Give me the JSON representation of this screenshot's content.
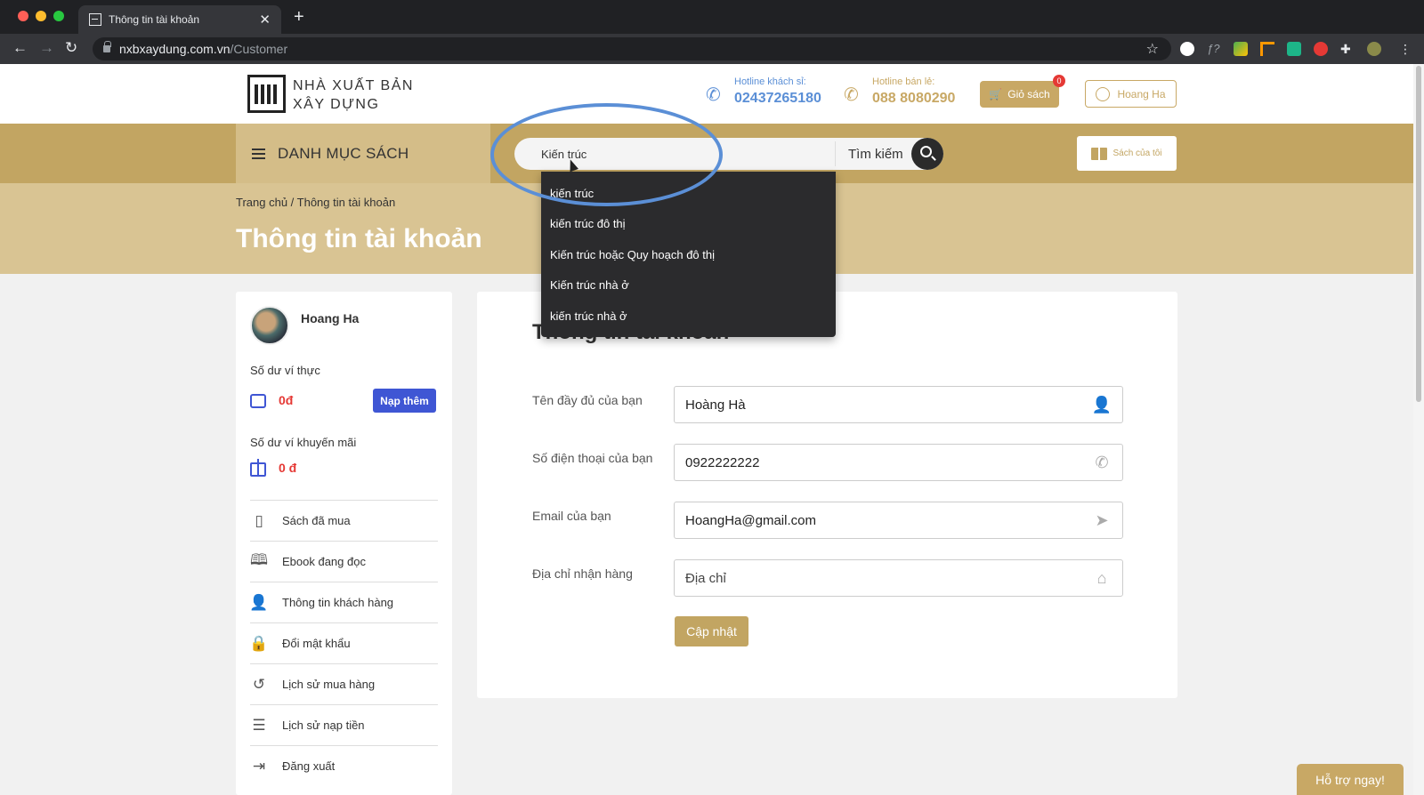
{
  "browser": {
    "tab_title": "Thông tin tài khoản",
    "url_domain": "nxbxaydung.com.vn",
    "url_path": "/Customer"
  },
  "header": {
    "logo_line1": "NHÀ XUẤT BẢN",
    "logo_line2": "XÂY DỰNG",
    "hotline_wholesale_label": "Hotline khách sỉ:",
    "hotline_wholesale_number": "02437265180",
    "hotline_retail_label": "Hotline bán lẻ:",
    "hotline_retail_number": "088 8080290",
    "cart_label": "Giỏ sách",
    "cart_count": "0",
    "user_label": "Hoang Ha",
    "colors": {
      "wholesale": "#5b8fd6",
      "retail": "#c8a865"
    }
  },
  "nav": {
    "menu_label": "DANH MỤC SÁCH",
    "search_value": "Kiến trúc",
    "search_button_label": "Tìm kiếm",
    "my_books_label": "Sách của tôi"
  },
  "search_suggestions": [
    "kiến trúc",
    "kiến trúc đô thị",
    "Kiến trúc hoặc Quy hoạch đô thị",
    "Kiến trúc nhà ở",
    "kiến trúc nhà ở"
  ],
  "banner": {
    "breadcrumb": "Trang chủ / Thông tin tài khoản",
    "title": "Thông tin tài khoản"
  },
  "sidebar": {
    "profile_name": "Hoang Ha",
    "real_wallet_label": "Số dư ví thực",
    "real_wallet_balance": "0đ",
    "topup_label": "Nạp thêm",
    "promo_wallet_label": "Số dư ví khuyến mãi",
    "promo_wallet_balance": "0 đ",
    "menu": [
      {
        "label": "Sách đã mua",
        "icon": "book-icon"
      },
      {
        "label": "Ebook đang đọc",
        "icon": "open-book-icon"
      },
      {
        "label": "Thông tin khách hàng",
        "icon": "user-icon"
      },
      {
        "label": "Đổi mật khẩu",
        "icon": "lock-icon"
      },
      {
        "label": "Lịch sử mua hàng",
        "icon": "history-icon"
      },
      {
        "label": "Lịch sử nạp tiền",
        "icon": "coins-icon"
      },
      {
        "label": "Đăng xuất",
        "icon": "logout-icon"
      }
    ]
  },
  "form": {
    "title": "Thông tin tài khoản",
    "fullname_label": "Tên đầy đủ của bạn",
    "fullname_value": "Hoàng Hà",
    "phone_label": "Số điện thoại của bạn",
    "phone_value": "0922222222",
    "email_label": "Email của bạn",
    "email_value": "HoangHa@gmail.com",
    "address_label": "Địa chỉ nhận hàng",
    "address_placeholder": "Địa chỉ",
    "update_label": "Cập nhật"
  },
  "support_label": "Hỗ trợ ngay!"
}
